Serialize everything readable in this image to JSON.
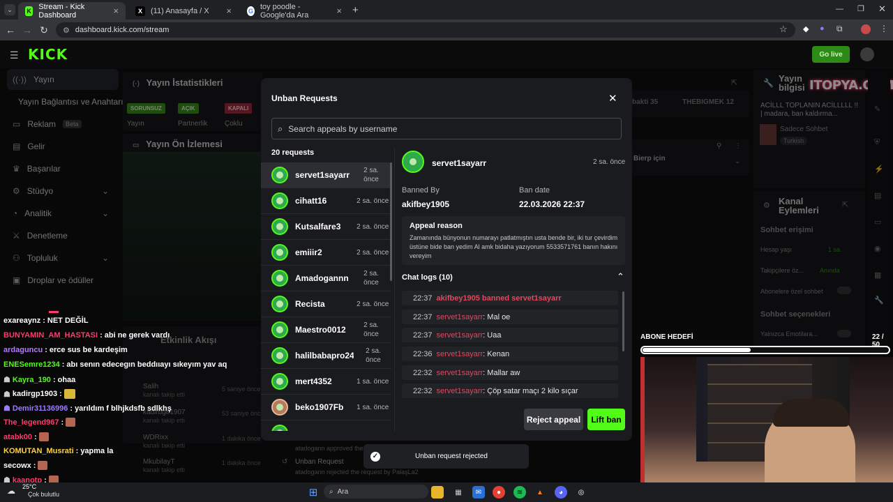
{
  "browser": {
    "tabs": [
      {
        "title": "Stream - Kick Dashboard",
        "icon": "kick-icon",
        "active": true
      },
      {
        "title": "(11) Anasayfa / X",
        "icon": "x-icon",
        "active": false
      },
      {
        "title": "toy poodle - Google'da Ara",
        "icon": "google-icon",
        "active": false
      }
    ],
    "url": "dashboard.kick.com/stream"
  },
  "app": {
    "logo": "KICK",
    "go_live": "Go live"
  },
  "sidebar": {
    "items": [
      {
        "label": "Yayın",
        "icon": "broadcast-icon"
      },
      {
        "label": "Yayın Bağlantısı ve Anahtarı",
        "icon": ""
      },
      {
        "label": "Reklam",
        "icon": "ad-icon",
        "badge": "Beta"
      },
      {
        "label": "Gelir",
        "icon": "wallet-icon"
      },
      {
        "label": "Başarılar",
        "icon": "trophy-icon"
      },
      {
        "label": "Stüdyo",
        "icon": "studio-icon"
      },
      {
        "label": "Analitik",
        "icon": "chart-icon"
      },
      {
        "label": "Denetleme",
        "icon": "sword-icon"
      },
      {
        "label": "Topluluk",
        "icon": "community-icon"
      },
      {
        "label": "Droplar ve ödüller",
        "icon": "gift-icon"
      }
    ]
  },
  "background": {
    "stats_title": "Yayın İstatistikleri",
    "preview_title": "Yayın Ön İzlemesi",
    "status_chips": [
      "SORUNSUZ",
      "AÇIK",
      "KAPALI"
    ],
    "status_labels": [
      "Yayın",
      "Partnerlik",
      "Çoklu"
    ],
    "activity_title": "Etkinlik Akışı",
    "activity_items": [
      {
        "name": "Salih",
        "sub": "kanalı takip etti",
        "time": "5 saniye önce"
      },
      {
        "name": "kadirbge1907",
        "sub": "kanalı takip etti",
        "time": "53 saniye önce"
      },
      {
        "name": "WDRixx",
        "sub": "kanalı takip etti",
        "time": "1 dakika önce"
      },
      {
        "name": "MkubilayT",
        "sub": "kanalı takip etti",
        "time": "1 dakika önce"
      }
    ],
    "unban_footer_title": "Unban Request",
    "unban_footer_sub": "atadogann rejected the request by PalaşLa2",
    "approved_text": "atadogann approved the",
    "channel_info_title": "Yayın bilgisi",
    "channel_info_title2": "ACİLLL TOPLANIN ACİLLLLL !! | madara, ban kaldırma...",
    "channel_info_cat": "Sadece Sohbet",
    "channel_info_lang": "Turkish",
    "channel_actions_title": "Kanal Eylemleri",
    "chat_access": "Sohbet erişimi",
    "account_age": "Hesap yaşı",
    "account_age_val": "1 sa.",
    "followers_only": "Takipçilere öz...",
    "followers_only_val": "Anında",
    "subs_only": "Abonelere özel sohbet",
    "chat_options": "Sohbet seçenekleri",
    "emotes_only": "Yalnızca Emotilara...",
    "pinned": "Bierp için",
    "top_names": [
      "bakti 35",
      "THEBIGMEK 12"
    ],
    "watermark": "ITOPYA.COM"
  },
  "chat_overlay": [
    {
      "user": "exareaynz",
      "color": "#ffffff",
      "msg": "NET DEĞİL"
    },
    {
      "user": "BUNYAMIN_AM_HASTASI",
      "color": "#ff3b6b",
      "msg": "abi ne gerek vardı"
    },
    {
      "user": "ardaguncu",
      "color": "#b57bff",
      "msg": "erce sus be kardeşim"
    },
    {
      "user": "ENESemre1234",
      "color": "#53fc18",
      "msg": "abı senın edecegın beddııayı sıkeyım yav aq"
    },
    {
      "user": "Kayra_190",
      "color": "#53fc18",
      "msg": "ohaa"
    },
    {
      "user": "kadirgp1903",
      "color": "#ffffff",
      "msg": ""
    },
    {
      "user": "Demir31136996",
      "color": "#9d7bff",
      "msg": "yarıldım f blhjkdsfb sdlkhş"
    },
    {
      "user": "The_legend967",
      "color": "#ff3b6b",
      "msg": ""
    },
    {
      "user": "atabk00",
      "color": "#ff3b6b",
      "msg": ""
    },
    {
      "user": "KOMUTAN_Musrati",
      "color": "#ffd23b",
      "msg": "yapma la"
    },
    {
      "user": "secowx",
      "color": "#ffffff",
      "msg": ""
    },
    {
      "user": "kaanotp",
      "color": "#ff3b6b",
      "msg": ""
    }
  ],
  "modal": {
    "title": "Unban Requests",
    "search_placeholder": "Search appeals by username",
    "count_label": "20 requests",
    "requests": [
      {
        "user": "servet1sayarr",
        "time": "2 sa. önce",
        "active": true
      },
      {
        "user": "cihatt16",
        "time": "2 sa. önce"
      },
      {
        "user": "Kutsalfare3",
        "time": "2 sa. önce"
      },
      {
        "user": "emiiir2",
        "time": "2 sa. önce"
      },
      {
        "user": "Amadogannn",
        "time": "2 sa. önce"
      },
      {
        "user": "Recista",
        "time": "2 sa. önce"
      },
      {
        "user": "Maestro0012",
        "time": "2 sa. önce"
      },
      {
        "user": "halilbabapro24",
        "time": "2 sa. önce"
      },
      {
        "user": "mert4352",
        "time": "1 sa. önce"
      },
      {
        "user": "beko1907Fb",
        "time": "1 sa. önce"
      }
    ],
    "detail": {
      "user": "servet1sayarr",
      "time": "2 sa. önce",
      "banned_by_label": "Banned By",
      "banned_by": "akifbey1905",
      "ban_date_label": "Ban date",
      "ban_date": "22.03.2026 22:37",
      "appeal_reason_label": "Appeal reason",
      "appeal_reason": "Zamanında bünyonun numarayı patlatmıştın usta bende bir, iki tur çevirdim üstüne bide ban yedim Al amk bidaha yazıyorum 5533571761 banın hakını vereyim",
      "chat_logs_label": "Chat logs (10)",
      "logs": [
        {
          "time": "22:37",
          "user": "akifbey1905",
          "text": "banned servet1sayarr",
          "system": true
        },
        {
          "time": "22:37",
          "user": "servet1sayarr",
          "text": ": Mal oe"
        },
        {
          "time": "22:37",
          "user": "servet1sayarr",
          "text": ": Uaa"
        },
        {
          "time": "22:36",
          "user": "servet1sayarr",
          "text": ": Kenan"
        },
        {
          "time": "22:32",
          "user": "servet1sayarr",
          "text": ": Mallar aw"
        },
        {
          "time": "22:32",
          "user": "servet1sayarr",
          "text": ": Çöp satar maçı 2 kilo sıçar"
        }
      ],
      "reject_label": "Reject appeal",
      "lift_label": "Lift ban"
    }
  },
  "toast": {
    "text": "Unban request rejected"
  },
  "webcam": {
    "goal_label": "ABONE HEDEFİ",
    "goal_count": "22 / 50",
    "goal_progress": 0.44
  },
  "taskbar": {
    "weather_temp": "25°C",
    "weather_desc": "Çok bulutlu",
    "search_placeholder": "Ara"
  },
  "colors": {
    "accent": "#53fc18",
    "danger": "#e0485f"
  }
}
